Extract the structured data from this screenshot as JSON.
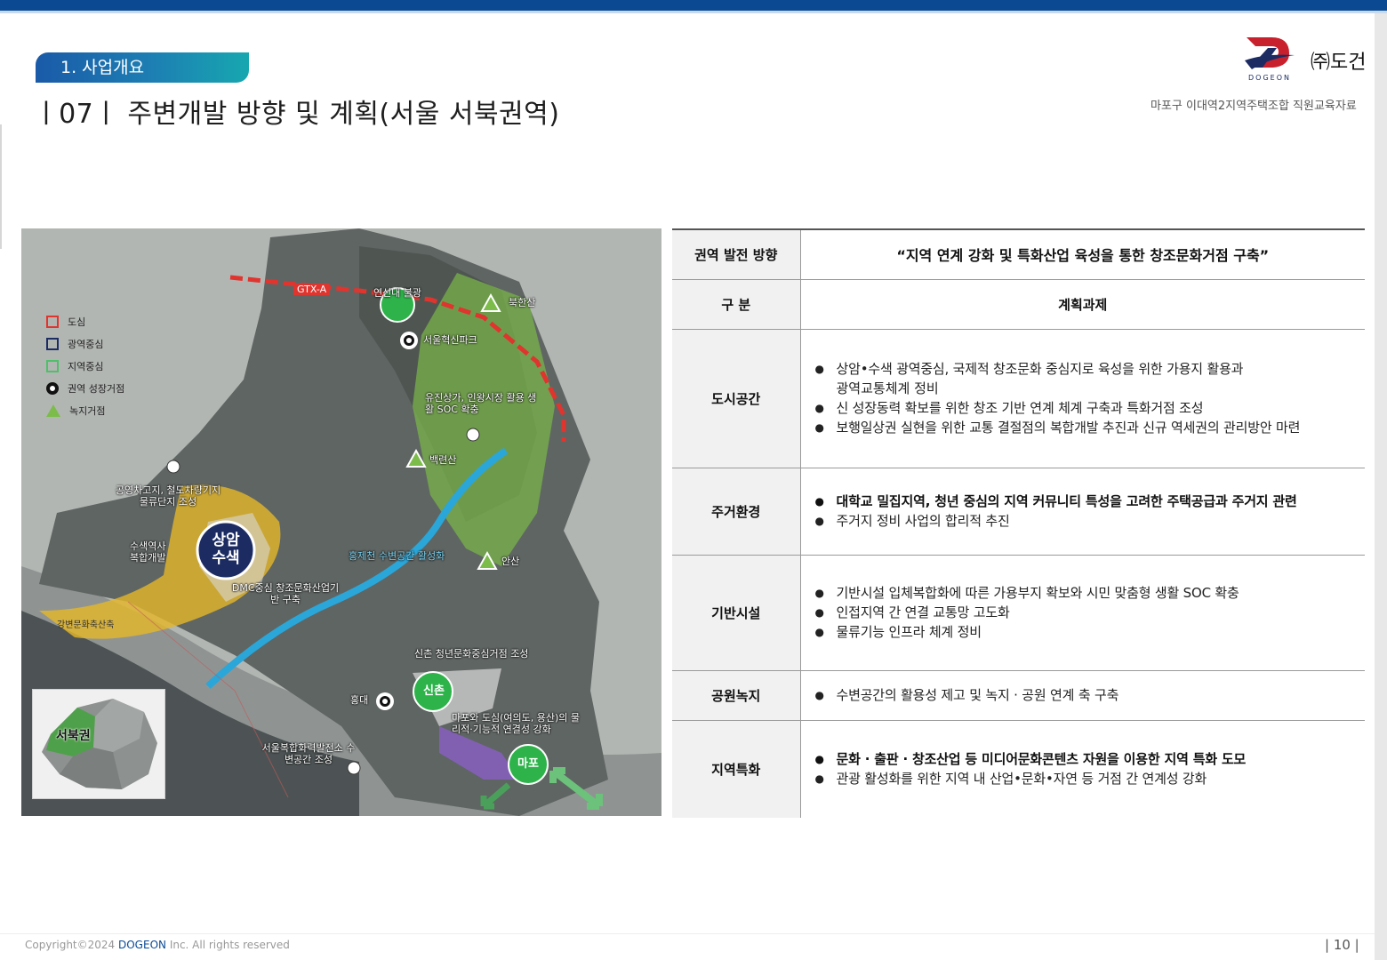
{
  "header": {
    "section_tab": "1. 사업개요",
    "page_title": "ㅣ07ㅣ  주변개발 방향 및 계획(서울 서북권역)",
    "company": "㈜도건",
    "logo_text": "DOGEON",
    "doc_subtitle": "마포구 이대역2지역주택조합 직원교육자료"
  },
  "map": {
    "legend": [
      {
        "label": "도심",
        "color": "#e0342f"
      },
      {
        "label": "광역중심",
        "color": "#1c2c63"
      },
      {
        "label": "지역중심",
        "color": "#4fbf6a"
      },
      {
        "label": "권역 성장거점",
        "color": "#111111"
      },
      {
        "label": "녹지거점",
        "color": "#7cbc4a"
      }
    ],
    "labels": {
      "gtx": "GTX-A",
      "yeonsinnae": "연신내 불광",
      "bukhansan": "북한산",
      "seoul_innovation_park": "서울혁신파크",
      "yujin": "유진상가, 인왕시장 활용 생활 SOC 확충",
      "baengnyeonsan": "백련산",
      "garage": "공영차고지, 철도차량기지 물류단지 조성",
      "susaek_station": "수색역사 복합개발",
      "sangam_susaek": "상암 수색",
      "hongje": "홍제천 수변공간 활성화",
      "ansan": "안산",
      "dmc": "DMC중심 창조문화산업기반 구축",
      "gangbyeon": "강변문화축산축",
      "sinchon_youth": "신촌 청년문화중심거점 조성",
      "sinchon": "신촌",
      "hongdae": "홍대",
      "mapo_link": "마포와 도심(여의도, 용산)의 물리적·기능적 연결성 강화",
      "seoul_complex": "서울복합화력발전소 수변공간 조성",
      "mapo": "마포"
    },
    "inset_labels": {
      "seobuk": "서북권"
    }
  },
  "table": {
    "vision_label": "권역 발전 방향",
    "vision": "“지역 연계 강화 및 특화산업 육성을 통한 창조문화거점 구축”",
    "col_category": "구 분",
    "col_tasks": "계획과제",
    "rows": [
      {
        "category": "도시공간",
        "items": [
          {
            "text": "상암•수색 광역중심, 국제적 창조문화 중심지로 육성을 위한 가용지 활용과",
            "cont": "광역교통체계 정비",
            "bold": false
          },
          {
            "text": "신 성장동력 확보를 위한 창조 기반 연계 체계 구축과 특화거점 조성",
            "bold": false
          },
          {
            "text": "보행일상권 실현을 위한 교통 결절점의 복합개발 추진과 신규 역세권의 관리방안 마련",
            "bold": false
          }
        ]
      },
      {
        "category": "주거환경",
        "items": [
          {
            "text": "대학교 밀집지역, 청년 중심의 지역 커뮤니티 특성을 고려한 주택공급과 주거지 관련",
            "bold": true
          },
          {
            "text": "주거지 정비 사업의 합리적 추진",
            "bold": false
          }
        ]
      },
      {
        "category": "기반시설",
        "items": [
          {
            "text": "기반시설 입체복합화에 따른 가용부지 확보와 시민 맞춤형 생활 SOC 확충",
            "bold": false
          },
          {
            "text": "인접지역 간 연결 교통망 고도화",
            "bold": false
          },
          {
            "text": "물류기능 인프라 체계 정비",
            "bold": false
          }
        ]
      },
      {
        "category": "공원녹지",
        "items": [
          {
            "text": "수변공간의 활용성 제고 및 녹지 · 공원 연계 축 구축",
            "bold": false
          }
        ]
      },
      {
        "category": "지역특화",
        "items": [
          {
            "text": "문화 · 출판 · 창조산업 등 미디어문화콘텐츠 자원을 이용한 지역 특화 도모",
            "bold": true
          },
          {
            "text": "관광 활성화를 위한 지역 내 산업•문화•자연 등 거점 간 연계성 강화",
            "bold": false
          }
        ]
      }
    ]
  },
  "footer": {
    "copyright_prefix": "Copyright©2024 ",
    "brand": "DOGEON",
    "copyright_suffix": " Inc. All rights reserved",
    "page_number": "| 10 |"
  },
  "colors": {
    "brand_blue": "#0b4a93",
    "tab_start": "#1a5aa8",
    "tab_end": "#17a7b0",
    "logo_red": "#c8202c",
    "logo_navy": "#1c2c63"
  }
}
